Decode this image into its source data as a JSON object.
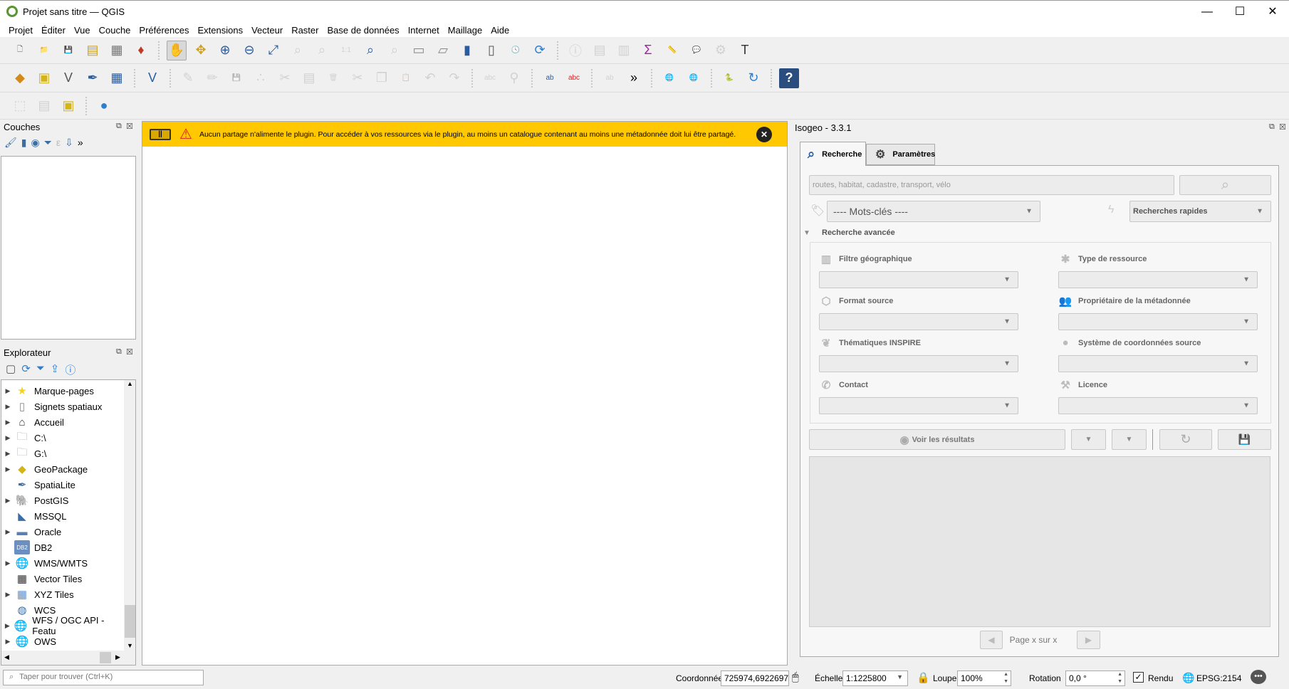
{
  "window": {
    "title": "Projet sans titre — QGIS",
    "min": "—",
    "max": "☐",
    "close": "✕"
  },
  "menu": [
    "Projet",
    "Éditer",
    "Vue",
    "Couche",
    "Préférences",
    "Extensions",
    "Vecteur",
    "Raster",
    "Base de données",
    "Internet",
    "Maillage",
    "Aide"
  ],
  "toolbars": {
    "row1": [
      [
        "new-project-icon",
        "🗋",
        "#555",
        0
      ],
      [
        "open-project-icon",
        "📁",
        "#e8b923",
        0
      ],
      [
        "save-project-icon",
        "💾",
        "#5a7fa8",
        0
      ],
      [
        "new-print-layout-icon",
        "▤",
        "#c9a227",
        0
      ],
      [
        "layout-manager-icon",
        "▦",
        "#777",
        0
      ],
      [
        "style-manager-icon",
        "♦",
        "#c0392b",
        0
      ],
      [
        "|"
      ],
      [
        "pan-icon",
        "✋",
        "#333",
        2
      ],
      [
        "pan-to-selection-icon",
        "✥",
        "#d4a017",
        0
      ],
      [
        "zoom-in-icon",
        "⊕",
        "#2a5d9f",
        0
      ],
      [
        "zoom-out-icon",
        "⊖",
        "#2a5d9f",
        0
      ],
      [
        "zoom-full-icon",
        "⤢",
        "#2a5d9f",
        0
      ],
      [
        "zoom-to-selection-icon",
        "⌕",
        "#999",
        1
      ],
      [
        "zoom-to-layer-icon",
        "⌕",
        "#999",
        1
      ],
      [
        "zoom-native-icon",
        "1:1",
        "#999",
        1
      ],
      [
        "zoom-last-icon",
        "⌕",
        "#2a5d9f",
        0
      ],
      [
        "zoom-next-icon",
        "⌕",
        "#999",
        1
      ],
      [
        "new-map-view-icon",
        "▭",
        "#888",
        0
      ],
      [
        "new-3d-map-icon",
        "▱",
        "#888",
        0
      ],
      [
        "new-bookmark-icon",
        "▮",
        "#2a5d9f",
        0
      ],
      [
        "show-bookmarks-icon",
        "▯",
        "#555",
        0
      ],
      [
        "temporal-controller-icon",
        "🕓",
        "#555",
        0
      ],
      [
        "refresh-icon",
        "⟳",
        "#2a7fd4",
        0
      ],
      [
        "|"
      ],
      [
        "identify-icon",
        "ⓘ",
        "#999",
        1
      ],
      [
        "attribute-table-icon",
        "▤",
        "#999",
        1
      ],
      [
        "field-calculator-icon",
        "▥",
        "#999",
        1
      ],
      [
        "statistics-icon",
        "Σ",
        "#a020a0",
        0
      ],
      [
        "measure-icon",
        "📏",
        "#444",
        0
      ],
      [
        "map-tips-icon",
        "💬",
        "#e8d21f",
        0
      ],
      [
        "select-icon",
        "⚙",
        "#999",
        1
      ],
      [
        "text-annotation-icon",
        "T",
        "#333",
        0
      ]
    ],
    "row2": [
      [
        "data-source-manager-icon",
        "◆",
        "#d48a1b",
        0
      ],
      [
        "new-geopackage-icon",
        "▣",
        "#d4b41b",
        0
      ],
      [
        "new-shapefile-icon",
        "V",
        "#555",
        0
      ],
      [
        "new-spatialite-icon",
        "✒",
        "#2a5d9f",
        0
      ],
      [
        "new-temp-layer-icon",
        "▦",
        "#2a5d9f",
        0
      ],
      [
        "|"
      ],
      [
        "new-virtual-layer-icon",
        "V",
        "#2a5d9f",
        0
      ],
      [
        "|"
      ],
      [
        "current-edits-icon",
        "✎",
        "#999",
        1
      ],
      [
        "toggle-editing-icon",
        "✏",
        "#999",
        1
      ],
      [
        "save-edits-icon",
        "💾",
        "#999",
        1
      ],
      [
        "digitize-icon",
        "∴",
        "#999",
        1
      ],
      [
        "vertex-tool-icon",
        "✂",
        "#999",
        1
      ],
      [
        "modify-attributes-icon",
        "▤",
        "#999",
        1
      ],
      [
        "delete-selected-icon",
        "🗑",
        "#999",
        1
      ],
      [
        "cut-icon",
        "✂",
        "#999",
        1
      ],
      [
        "copy-icon",
        "❐",
        "#999",
        1
      ],
      [
        "paste-icon",
        "📋",
        "#999",
        1
      ],
      [
        "undo-icon",
        "↶",
        "#999",
        1
      ],
      [
        "redo-icon",
        "↷",
        "#999",
        1
      ],
      [
        "|"
      ],
      [
        "label-icon",
        "abc",
        "#999",
        1
      ],
      [
        "pin-labels-icon",
        "⚲",
        "#999",
        1
      ],
      [
        "|"
      ],
      [
        "label-highlight-icon",
        "ab",
        "#2a5d9f",
        0
      ],
      [
        "label-red-icon",
        "abc",
        "#e02020",
        0
      ],
      [
        "|"
      ],
      [
        "label-tool-icon",
        "ab",
        "#999",
        1
      ],
      [
        "more-icon",
        "»",
        "#000",
        0
      ],
      [
        "|"
      ],
      [
        "add-wms-icon",
        "🌐",
        "#2a5d9f",
        0
      ],
      [
        "metasearch-icon",
        "🌐",
        "#2a5d9f",
        0
      ],
      [
        "|"
      ],
      [
        "python-icon",
        "🐍",
        "#3a75b0",
        0
      ],
      [
        "plugin-reload-icon",
        "↻",
        "#2a7fd4",
        0
      ],
      [
        "|"
      ],
      [
        "help-icon",
        "?",
        "#fff",
        3
      ]
    ],
    "row3": [
      [
        "select-features-icon",
        "⬚",
        "#999",
        1
      ],
      [
        "attribute-form-icon",
        "▤",
        "#999",
        1
      ],
      [
        "deselect-icon",
        "▣",
        "#d4b41b",
        0
      ],
      [
        "|"
      ],
      [
        "isogeo-plugin-icon",
        "●",
        "#2a7fd4",
        0
      ]
    ]
  },
  "layers_panel": {
    "title": "Couches",
    "tools": [
      "paint-icon",
      "add-group-icon",
      "visibility-icon",
      "filter-icon",
      "expression-filter-icon",
      "move-down-icon",
      "more-icon"
    ],
    "more": "»"
  },
  "browser_panel": {
    "title": "Explorateur",
    "items": [
      {
        "label": "Marque-pages",
        "icon": "star-icon",
        "glyph": "★",
        "color": "#f5d21b",
        "expand": true
      },
      {
        "label": "Signets spatiaux",
        "icon": "spatial-bookmark-icon",
        "glyph": "▯",
        "color": "#888",
        "expand": true
      },
      {
        "label": "Accueil",
        "icon": "home-icon",
        "glyph": "⌂",
        "color": "#333",
        "expand": true
      },
      {
        "label": "C:\\",
        "icon": "folder-icon",
        "glyph": "🗀",
        "color": "#999",
        "expand": true
      },
      {
        "label": "G:\\",
        "icon": "folder-icon",
        "glyph": "🗀",
        "color": "#999",
        "expand": true
      },
      {
        "label": "GeoPackage",
        "icon": "geopackage-icon",
        "glyph": "◆",
        "color": "#d4b41b",
        "expand": true
      },
      {
        "label": "SpatiaLite",
        "icon": "spatialite-icon",
        "glyph": "✒",
        "color": "#3a6ea5",
        "expand": false
      },
      {
        "label": "PostGIS",
        "icon": "postgis-icon",
        "glyph": "🐘",
        "color": "#3a6ea5",
        "expand": true
      },
      {
        "label": "MSSQL",
        "icon": "mssql-icon",
        "glyph": "◣",
        "color": "#3a6ea5",
        "expand": false
      },
      {
        "label": "Oracle",
        "icon": "oracle-icon",
        "glyph": "▬",
        "color": "#5a7fb0",
        "expand": true
      },
      {
        "label": "DB2",
        "icon": "db2-icon",
        "glyph": "DB2",
        "color": "#6a8fc0",
        "expand": false
      },
      {
        "label": "WMS/WMTS",
        "icon": "wms-icon",
        "glyph": "🌐",
        "color": "#3a6ea5",
        "expand": true
      },
      {
        "label": "Vector Tiles",
        "icon": "vector-tiles-icon",
        "glyph": "▦",
        "color": "#333",
        "expand": false
      },
      {
        "label": "XYZ Tiles",
        "icon": "xyz-tiles-icon",
        "glyph": "▦",
        "color": "#5a8fd0",
        "expand": true
      },
      {
        "label": "WCS",
        "icon": "wcs-icon",
        "glyph": "◍",
        "color": "#3a6ea5",
        "expand": false
      },
      {
        "label": "WFS / OGC API - Featu",
        "icon": "wfs-icon",
        "glyph": "🌐",
        "color": "#3a6ea5",
        "expand": true
      },
      {
        "label": "OWS",
        "icon": "ows-icon",
        "glyph": "🌐",
        "color": "#3a6ea5",
        "expand": true
      }
    ]
  },
  "message_bar": {
    "text": "Aucun partage n'alimente le plugin. Pour accéder à vos ressources via le plugin, au moins un catalogue contenant au moins une métadonnée doit lui être partagé.",
    "color": "#ffc800"
  },
  "isogeo": {
    "title": "Isogeo - 3.3.1",
    "tabs": [
      {
        "label": "Recherche",
        "active": true
      },
      {
        "label": "Paramètres",
        "active": false
      }
    ],
    "search_placeholder": "routes, habitat, cadastre, transport, vélo",
    "keywords": "---- Mots-clés ----",
    "quick_searches": "Recherches rapides",
    "advanced": "Recherche avancée",
    "filters": [
      {
        "label": "Filtre géographique",
        "icon": "map-icon",
        "glyph": "▥"
      },
      {
        "label": "Type de ressource",
        "icon": "asterisk-icon",
        "glyph": "✱"
      },
      {
        "label": "Format source",
        "icon": "cube-icon",
        "glyph": "⬡"
      },
      {
        "label": "Propriétaire de la métadonnée",
        "icon": "users-icon",
        "glyph": "👥"
      },
      {
        "label": "Thématiques INSPIRE",
        "icon": "leaf-icon",
        "glyph": "❦"
      },
      {
        "label": "Système de coordonnées source",
        "icon": "circle-icon",
        "glyph": "●"
      },
      {
        "label": "Contact",
        "icon": "phone-icon",
        "glyph": "✆"
      },
      {
        "label": "Licence",
        "icon": "gavel-icon",
        "glyph": "⚒"
      }
    ],
    "show_results": "Voir les résultats",
    "pager": "Page x sur x"
  },
  "locator_placeholder": "Taper pour trouver (Ctrl+K)",
  "status": {
    "coord_label": "Coordonnée",
    "coord": "725974,6922697",
    "scale_label": "Échelle",
    "scale": "1:1225800",
    "magnifier_label": "Loupe",
    "magnifier": "100%",
    "rotation_label": "Rotation",
    "rotation": "0,0 °",
    "render_label": "Rendu",
    "render_checked": true,
    "crs": "EPSG:2154"
  }
}
